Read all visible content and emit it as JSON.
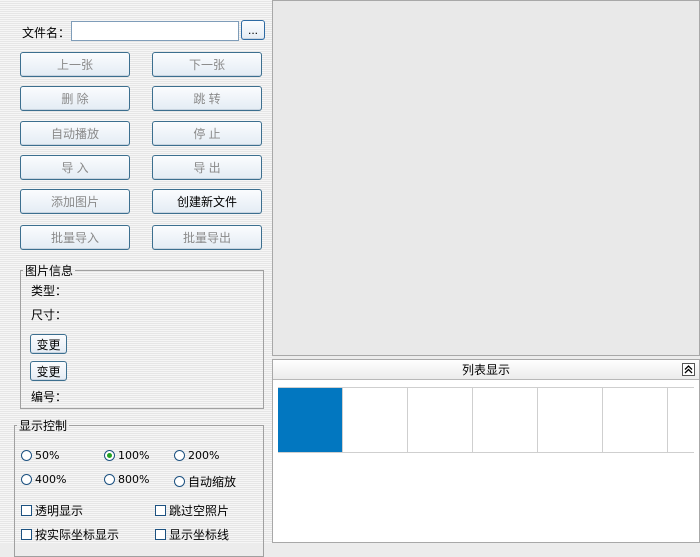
{
  "file": {
    "label": "文件名：",
    "value": "",
    "browse_label": "..."
  },
  "buttons": {
    "prev": "上一张",
    "next": "下一张",
    "delete": "删  除",
    "jump": "跳  转",
    "autoplay": "自动播放",
    "stop": "停  止",
    "import": "导  入",
    "export": "导  出",
    "add_image": "添加图片",
    "new_file": "创建新文件",
    "batch_import": "批量导入",
    "batch_export": "批量导出"
  },
  "info": {
    "legend": "图片信息",
    "type_label": "类型：",
    "size_label": "尺寸：",
    "change1": "变更",
    "change2": "变更",
    "id_label": "编号："
  },
  "display": {
    "legend": "显示控制",
    "zoom_options": [
      "50%",
      "100%",
      "200%",
      "400%",
      "800%",
      "自动缩放"
    ],
    "zoom_selected": "100%",
    "checks": [
      "透明显示",
      "跳过空照片",
      "按实际坐标显示",
      "显示坐标线"
    ]
  },
  "list": {
    "title": "列表显示",
    "collapse_icon": "double-chevron-up-icon",
    "thumb_count": 6,
    "selected_index": 0
  },
  "colors": {
    "selection": "#0277c0",
    "button_border": "#3c6f8f",
    "radio_dot": "#21a121"
  }
}
